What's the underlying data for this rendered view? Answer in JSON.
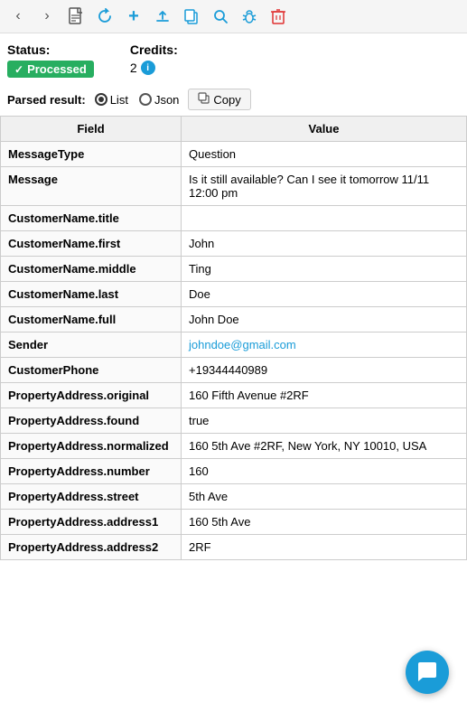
{
  "toolbar": {
    "icons": [
      {
        "name": "back-icon",
        "symbol": "‹",
        "color": "default"
      },
      {
        "name": "forward-icon",
        "symbol": "›",
        "color": "default"
      },
      {
        "name": "document-icon",
        "symbol": "📄",
        "color": "default"
      },
      {
        "name": "refresh-icon",
        "symbol": "↻",
        "color": "blue"
      },
      {
        "name": "plus-icon",
        "symbol": "+",
        "color": "blue"
      },
      {
        "name": "upload-icon",
        "symbol": "⬆",
        "color": "blue"
      },
      {
        "name": "copy-toolbar-icon",
        "symbol": "⧉",
        "color": "blue"
      },
      {
        "name": "search-icon",
        "symbol": "🔍",
        "color": "blue"
      },
      {
        "name": "bug-icon",
        "symbol": "🐞",
        "color": "blue"
      },
      {
        "name": "delete-icon",
        "symbol": "🗑",
        "color": "red"
      }
    ]
  },
  "status": {
    "label": "Status:",
    "badge_text": "Processed",
    "badge_checkmark": "✓"
  },
  "credits": {
    "label": "Credits:",
    "value": "2"
  },
  "parsed_result": {
    "label": "Parsed result:",
    "radio_list": "List",
    "radio_json": "Json",
    "copy_label": "Copy"
  },
  "table": {
    "col_field": "Field",
    "col_value": "Value",
    "rows": [
      {
        "field": "MessageType",
        "value": "Question",
        "is_link": false
      },
      {
        "field": "Message",
        "value": "Is it still available? Can I see it tomorrow 11/11 12:00 pm",
        "is_link": false
      },
      {
        "field": "CustomerName.title",
        "value": "",
        "is_link": false
      },
      {
        "field": "CustomerName.first",
        "value": "John",
        "is_link": false
      },
      {
        "field": "CustomerName.middle",
        "value": "Ting",
        "is_link": false
      },
      {
        "field": "CustomerName.last",
        "value": "Doe",
        "is_link": false
      },
      {
        "field": "CustomerName.full",
        "value": "John Doe",
        "is_link": false
      },
      {
        "field": "Sender",
        "value": "johndoe@gmail.com",
        "is_link": true
      },
      {
        "field": "CustomerPhone",
        "value": "+19344440989",
        "is_link": false
      },
      {
        "field": "PropertyAddress.original",
        "value": "160 Fifth Avenue #2RF",
        "is_link": false
      },
      {
        "field": "PropertyAddress.found",
        "value": "true",
        "is_link": false
      },
      {
        "field": "PropertyAddress.normalized",
        "value": "160 5th Ave #2RF, New York, NY 10010, USA",
        "is_link": false
      },
      {
        "field": "PropertyAddress.number",
        "value": "160",
        "is_link": false
      },
      {
        "field": "PropertyAddress.street",
        "value": "5th Ave",
        "is_link": false
      },
      {
        "field": "PropertyAddress.address1",
        "value": "160 5th Ave",
        "is_link": false
      },
      {
        "field": "PropertyAddress.address2",
        "value": "2RF",
        "is_link": false
      }
    ]
  },
  "chat": {
    "icon": "💬"
  }
}
